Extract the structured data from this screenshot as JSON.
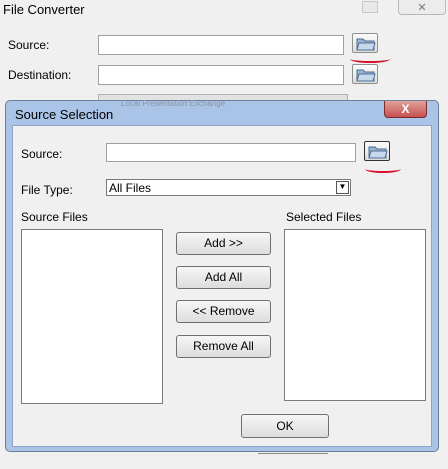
{
  "main": {
    "title": "File Converter",
    "source_label": "Source:",
    "destination_label": "Destination:",
    "faint_text": "Local Presentation Exchange"
  },
  "dialog": {
    "title": "Source Selection",
    "close_label": "X",
    "source_label": "Source:",
    "source_value": "",
    "file_type_label": "File Type:",
    "file_type_value": "All Files",
    "source_files_label": "Source Files",
    "selected_files_label": "Selected Files",
    "add_label": "Add >>",
    "add_all_label": "Add All",
    "remove_label": "<< Remove",
    "remove_all_label": "Remove All",
    "ok_label": "OK"
  },
  "colors": {
    "annotation_red": "#d8102a",
    "close_button": "#c75050",
    "dialog_frame": "#a9c4e6"
  }
}
